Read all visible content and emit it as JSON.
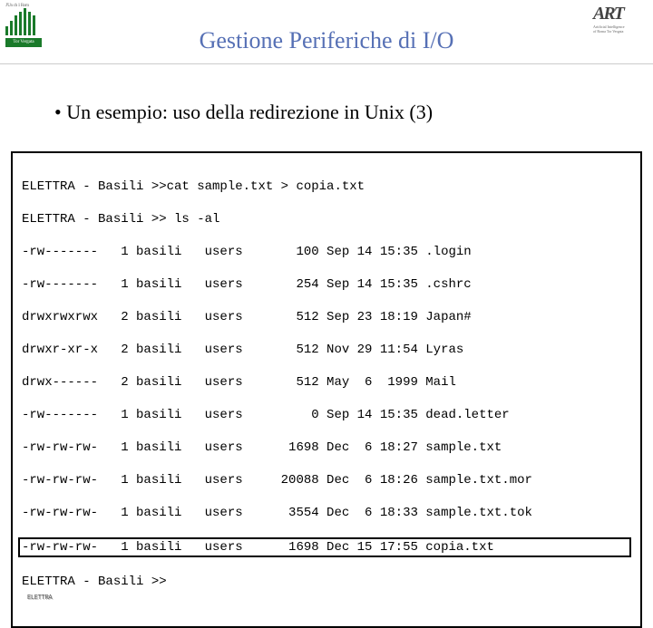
{
  "header": {
    "left_tiny": "J'Un ch 1 Rom",
    "left_caption": "Tor Vergata",
    "right_main": "ART",
    "right_sub1": "Artificial Intelligence",
    "right_sub2": "of Roma Tor Vergata"
  },
  "title": "Gestione Periferiche di I/O",
  "bullet": "Un esempio: uso della redirezione in Unix (3)",
  "terminal": {
    "l0": "ELETTRA - Basili >>cat sample.txt > copia.txt",
    "l1": "ELETTRA - Basili >> ls -al",
    "l2": "-rw-------   1 basili   users       100 Sep 14 15:35 .login",
    "l3": "-rw-------   1 basili   users       254 Sep 14 15:35 .cshrc",
    "l4": "drwxrwxrwx   2 basili   users       512 Sep 23 18:19 Japan#",
    "l5": "drwxr-xr-x   2 basili   users       512 Nov 29 11:54 Lyras",
    "l6": "drwx------   2 basili   users       512 May  6  1999 Mail",
    "l7": "-rw-------   1 basili   users         0 Sep 14 15:35 dead.letter",
    "l8": "-rw-rw-rw-   1 basili   users      1698 Dec  6 18:27 sample.txt",
    "l9": "-rw-rw-rw-   1 basili   users     20088 Dec  6 18:26 sample.txt.mor",
    "l10": "-rw-rw-rw-   1 basili   users      3554 Dec  6 18:33 sample.txt.tok",
    "l11": "-rw-rw-rw-   1 basili   users      1698 Dec 15 17:55 copia.txt",
    "l12": "ELETTRA - Basili >>",
    "shadow": "ELETTRA"
  }
}
